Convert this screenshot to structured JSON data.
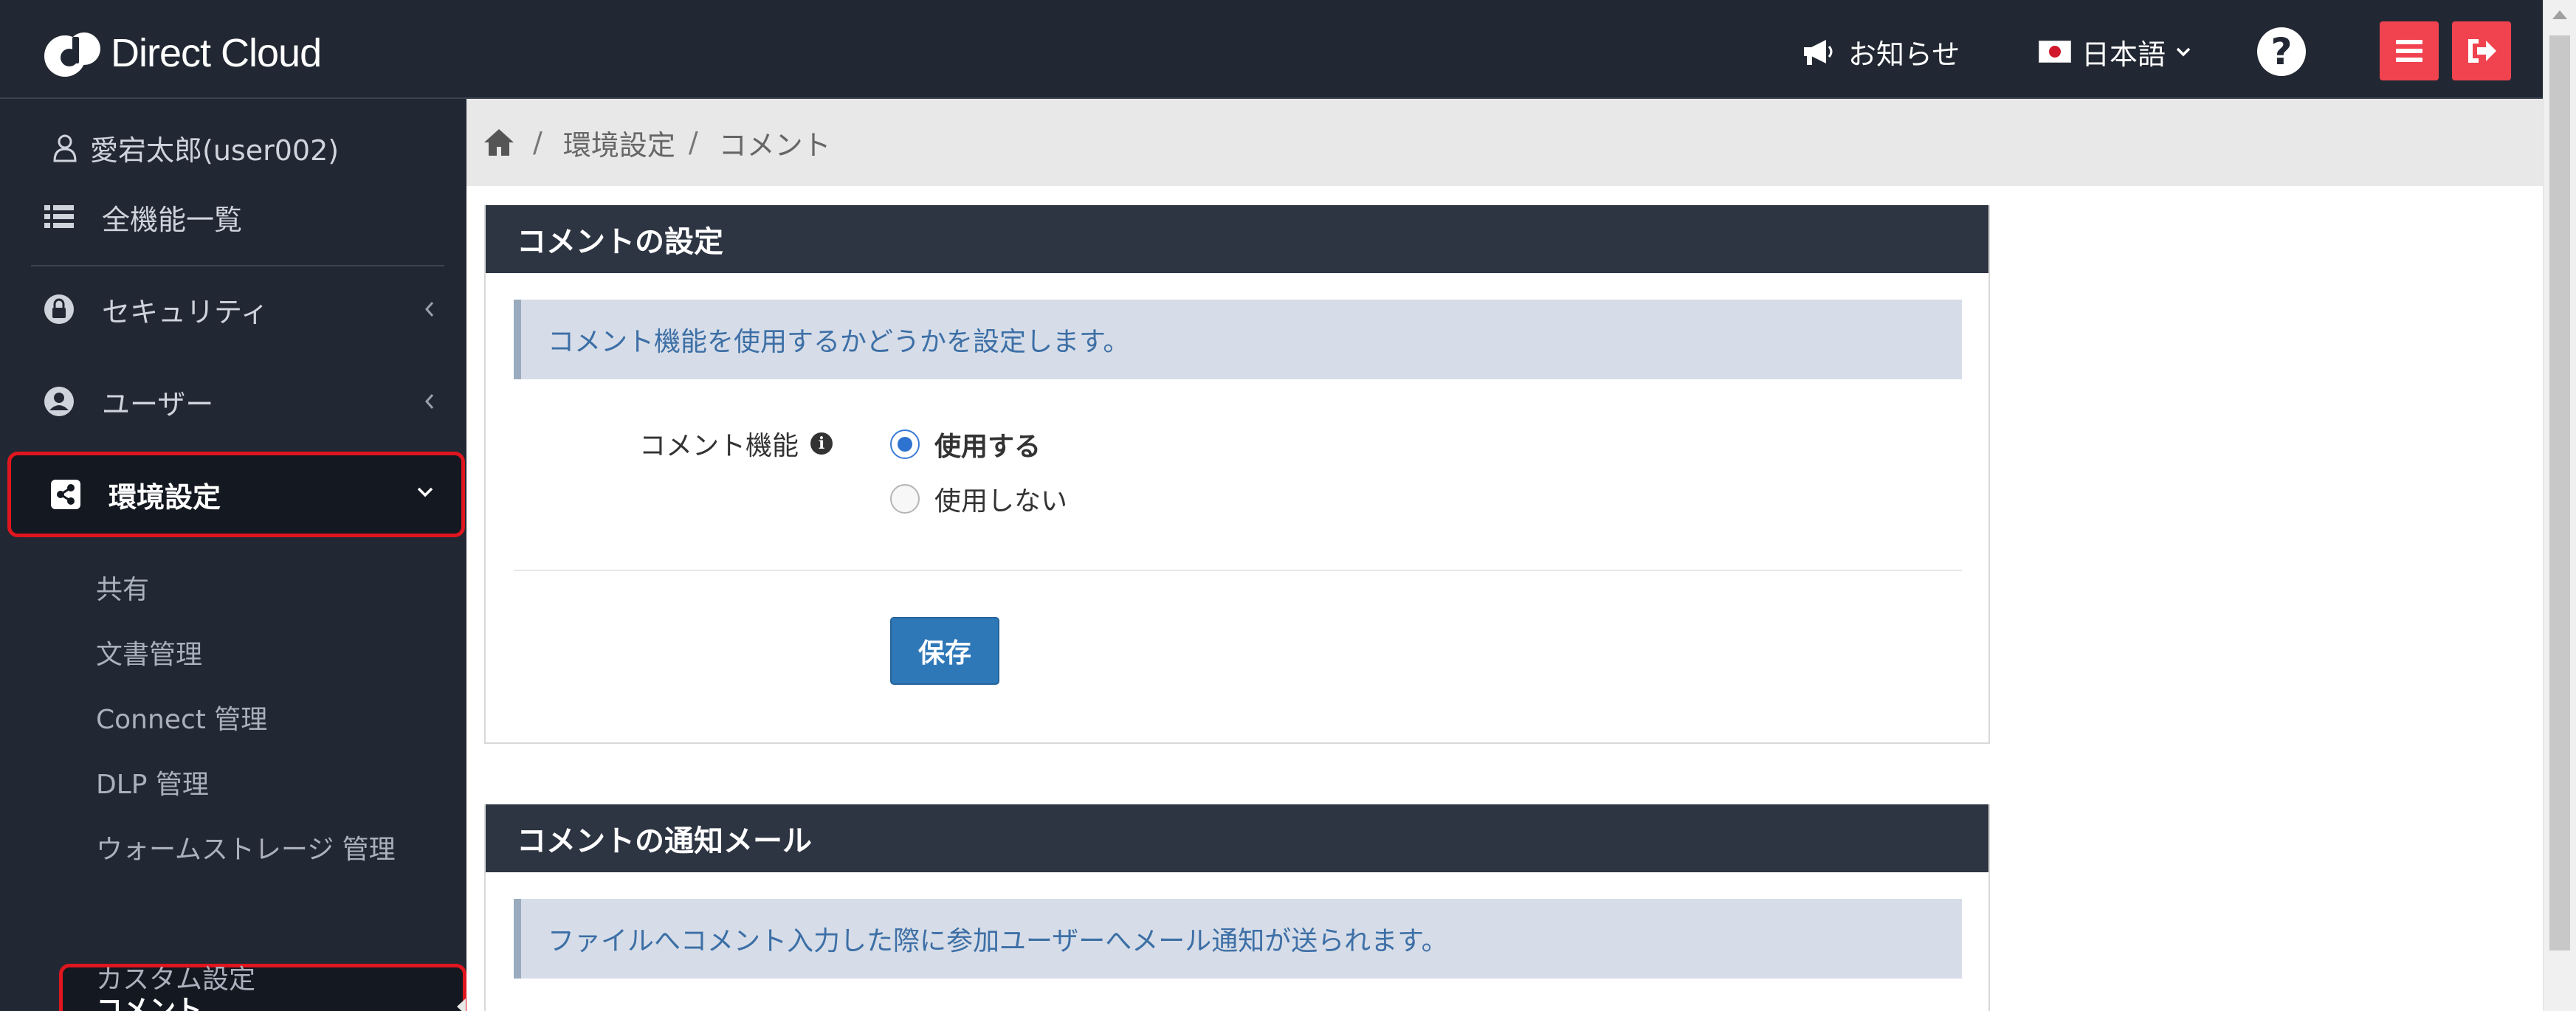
{
  "header": {
    "brand": "Direct Cloud",
    "news_label": "お知らせ",
    "language_label": "日本語",
    "help_glyph": "?",
    "icons": [
      "megaphone-icon",
      "japan-flag-icon",
      "help-icon",
      "menu-icon",
      "logout-icon"
    ],
    "accent_color": "#f0434f"
  },
  "sidebar": {
    "user_label": "愛宕太郎(user002)",
    "all_features": "全機能一覧",
    "security": "セキュリティ",
    "users": "ユーザー",
    "env_settings": "環境設定",
    "sub_items": [
      "共有",
      "文書管理",
      "Connect 管理",
      "DLP 管理",
      "ウォームストレージ 管理",
      "コメント",
      "カスタム設定"
    ],
    "active_sub": "コメント"
  },
  "breadcrumb": {
    "items": [
      "環境設定",
      "コメント"
    ],
    "sep": "/"
  },
  "comment_settings": {
    "title": "コメントの設定",
    "info": "コメント機能を使用するかどうかを設定します。",
    "field_label": "コメント機能",
    "option_on": "使用する",
    "option_off": "使用しない",
    "selected": "使用する",
    "save_label": "保存"
  },
  "comment_mail": {
    "title": "コメントの通知メール",
    "info": "ファイルへコメント入力した際に参加ユーザーへメール通知が送られます。"
  }
}
